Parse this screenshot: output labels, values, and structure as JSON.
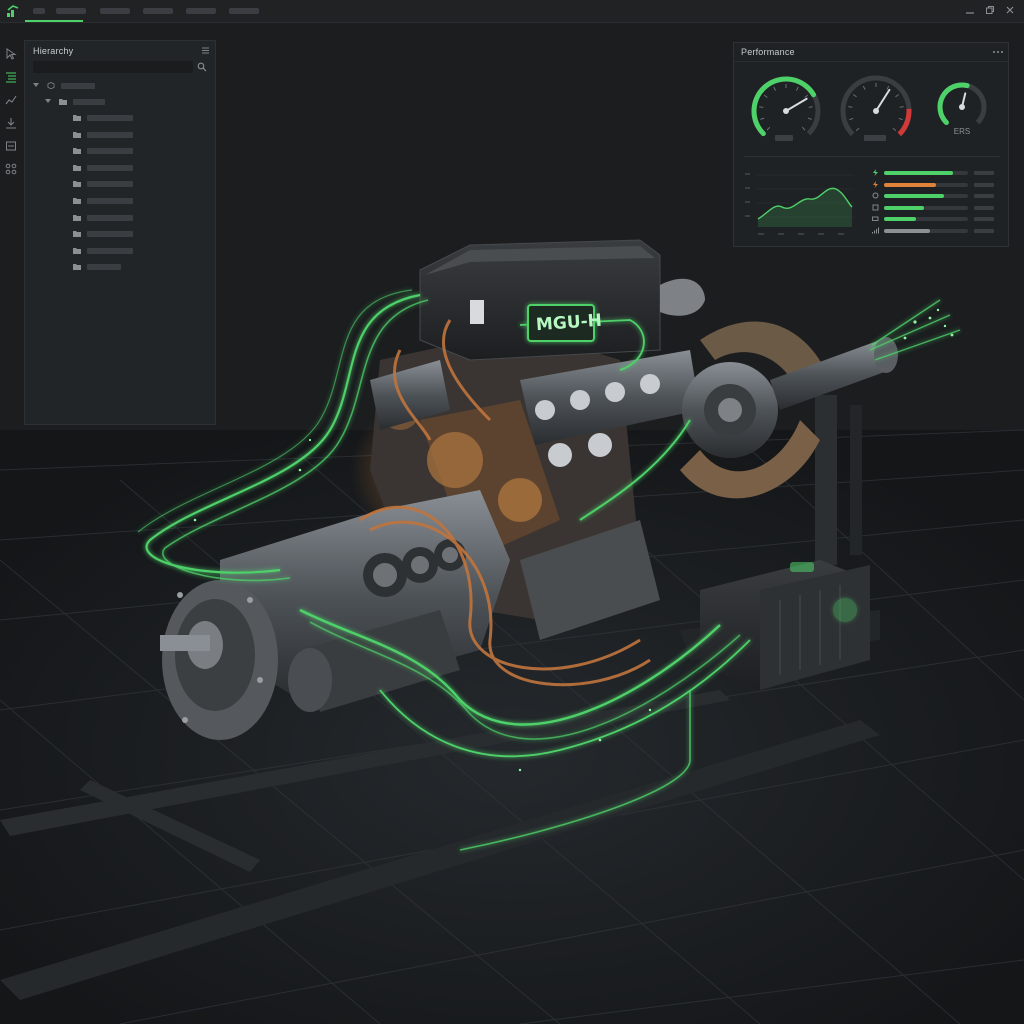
{
  "hierarchy": {
    "title": "Hierarchy"
  },
  "performance": {
    "title": "Performance",
    "gauges": {
      "left_level": 0.72,
      "center_level": 0.62,
      "ers_label": "ERS",
      "ers_level": 0.55
    },
    "metrics": [
      {
        "icon": "lightning-icon",
        "color": "#4fd16a",
        "level": 0.82
      },
      {
        "icon": "lightning-icon",
        "color": "#e0823a",
        "level": 0.62
      },
      {
        "icon": "gear-icon",
        "color": "#4fd16a",
        "level": 0.72
      },
      {
        "icon": "thermometer-icon",
        "color": "#4fd16a",
        "level": 0.48
      },
      {
        "icon": "battery-icon",
        "color": "#4fd16a",
        "level": 0.38
      },
      {
        "icon": "signal-icon",
        "color": "#8b9095",
        "level": 0.55
      }
    ]
  },
  "engine": {
    "label_mgu_h": "MGU-H"
  },
  "colors": {
    "accent": "#4fd16a",
    "orange": "#e0823a",
    "red": "#d23a3a"
  }
}
